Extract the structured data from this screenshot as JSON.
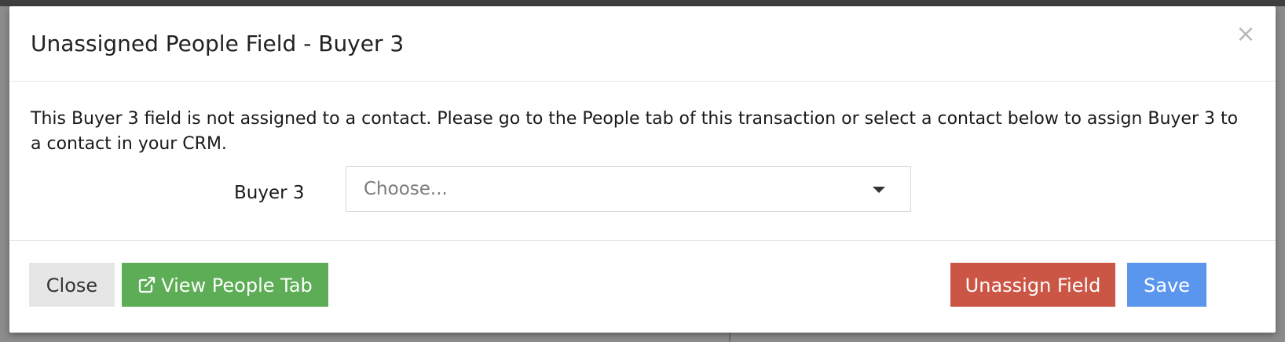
{
  "modal": {
    "title": "Unassigned People Field - Buyer 3",
    "close_symbol": "×",
    "message": "This Buyer 3 field is not assigned to a contact. Please go to the People tab of this transaction or select a contact below to assign Buyer 3 to a contact in your CRM.",
    "field": {
      "label": "Buyer 3",
      "selected_value": "Choose..."
    },
    "footer": {
      "close_label": "Close",
      "view_people_label": "View People Tab",
      "unassign_label": "Unassign Field",
      "save_label": "Save"
    }
  },
  "icons": {
    "close": "close-icon",
    "external_link": "external-link-icon",
    "dropdown": "caret-down-icon"
  },
  "colors": {
    "view_people_button": "#5cad56",
    "unassign_button": "#cc5645",
    "save_button": "#5b96ee",
    "close_button": "#e6e6e6"
  }
}
